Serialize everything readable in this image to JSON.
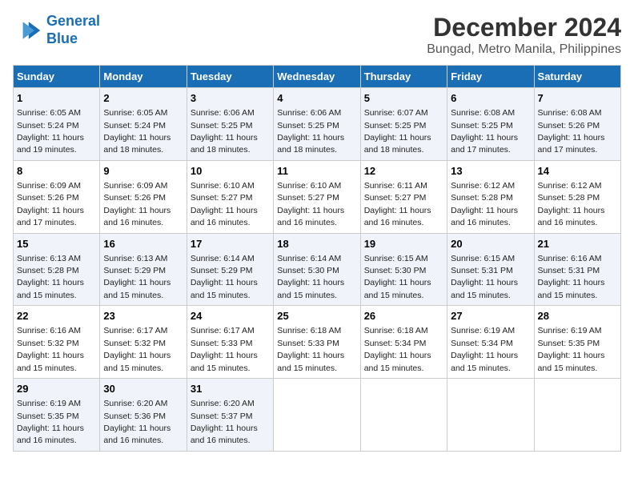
{
  "header": {
    "logo_line1": "General",
    "logo_line2": "Blue",
    "title": "December 2024",
    "subtitle": "Bungad, Metro Manila, Philippines"
  },
  "days_of_week": [
    "Sunday",
    "Monday",
    "Tuesday",
    "Wednesday",
    "Thursday",
    "Friday",
    "Saturday"
  ],
  "weeks": [
    [
      {
        "day": 1,
        "sunrise": "6:05 AM",
        "sunset": "5:24 PM",
        "daylight": "11 hours and 19 minutes."
      },
      {
        "day": 2,
        "sunrise": "6:05 AM",
        "sunset": "5:24 PM",
        "daylight": "11 hours and 18 minutes."
      },
      {
        "day": 3,
        "sunrise": "6:06 AM",
        "sunset": "5:25 PM",
        "daylight": "11 hours and 18 minutes."
      },
      {
        "day": 4,
        "sunrise": "6:06 AM",
        "sunset": "5:25 PM",
        "daylight": "11 hours and 18 minutes."
      },
      {
        "day": 5,
        "sunrise": "6:07 AM",
        "sunset": "5:25 PM",
        "daylight": "11 hours and 18 minutes."
      },
      {
        "day": 6,
        "sunrise": "6:08 AM",
        "sunset": "5:25 PM",
        "daylight": "11 hours and 17 minutes."
      },
      {
        "day": 7,
        "sunrise": "6:08 AM",
        "sunset": "5:26 PM",
        "daylight": "11 hours and 17 minutes."
      }
    ],
    [
      {
        "day": 8,
        "sunrise": "6:09 AM",
        "sunset": "5:26 PM",
        "daylight": "11 hours and 17 minutes."
      },
      {
        "day": 9,
        "sunrise": "6:09 AM",
        "sunset": "5:26 PM",
        "daylight": "11 hours and 16 minutes."
      },
      {
        "day": 10,
        "sunrise": "6:10 AM",
        "sunset": "5:27 PM",
        "daylight": "11 hours and 16 minutes."
      },
      {
        "day": 11,
        "sunrise": "6:10 AM",
        "sunset": "5:27 PM",
        "daylight": "11 hours and 16 minutes."
      },
      {
        "day": 12,
        "sunrise": "6:11 AM",
        "sunset": "5:27 PM",
        "daylight": "11 hours and 16 minutes."
      },
      {
        "day": 13,
        "sunrise": "6:12 AM",
        "sunset": "5:28 PM",
        "daylight": "11 hours and 16 minutes."
      },
      {
        "day": 14,
        "sunrise": "6:12 AM",
        "sunset": "5:28 PM",
        "daylight": "11 hours and 16 minutes."
      }
    ],
    [
      {
        "day": 15,
        "sunrise": "6:13 AM",
        "sunset": "5:28 PM",
        "daylight": "11 hours and 15 minutes."
      },
      {
        "day": 16,
        "sunrise": "6:13 AM",
        "sunset": "5:29 PM",
        "daylight": "11 hours and 15 minutes."
      },
      {
        "day": 17,
        "sunrise": "6:14 AM",
        "sunset": "5:29 PM",
        "daylight": "11 hours and 15 minutes."
      },
      {
        "day": 18,
        "sunrise": "6:14 AM",
        "sunset": "5:30 PM",
        "daylight": "11 hours and 15 minutes."
      },
      {
        "day": 19,
        "sunrise": "6:15 AM",
        "sunset": "5:30 PM",
        "daylight": "11 hours and 15 minutes."
      },
      {
        "day": 20,
        "sunrise": "6:15 AM",
        "sunset": "5:31 PM",
        "daylight": "11 hours and 15 minutes."
      },
      {
        "day": 21,
        "sunrise": "6:16 AM",
        "sunset": "5:31 PM",
        "daylight": "11 hours and 15 minutes."
      }
    ],
    [
      {
        "day": 22,
        "sunrise": "6:16 AM",
        "sunset": "5:32 PM",
        "daylight": "11 hours and 15 minutes."
      },
      {
        "day": 23,
        "sunrise": "6:17 AM",
        "sunset": "5:32 PM",
        "daylight": "11 hours and 15 minutes."
      },
      {
        "day": 24,
        "sunrise": "6:17 AM",
        "sunset": "5:33 PM",
        "daylight": "11 hours and 15 minutes."
      },
      {
        "day": 25,
        "sunrise": "6:18 AM",
        "sunset": "5:33 PM",
        "daylight": "11 hours and 15 minutes."
      },
      {
        "day": 26,
        "sunrise": "6:18 AM",
        "sunset": "5:34 PM",
        "daylight": "11 hours and 15 minutes."
      },
      {
        "day": 27,
        "sunrise": "6:19 AM",
        "sunset": "5:34 PM",
        "daylight": "11 hours and 15 minutes."
      },
      {
        "day": 28,
        "sunrise": "6:19 AM",
        "sunset": "5:35 PM",
        "daylight": "11 hours and 15 minutes."
      }
    ],
    [
      {
        "day": 29,
        "sunrise": "6:19 AM",
        "sunset": "5:35 PM",
        "daylight": "11 hours and 16 minutes."
      },
      {
        "day": 30,
        "sunrise": "6:20 AM",
        "sunset": "5:36 PM",
        "daylight": "11 hours and 16 minutes."
      },
      {
        "day": 31,
        "sunrise": "6:20 AM",
        "sunset": "5:37 PM",
        "daylight": "11 hours and 16 minutes."
      },
      null,
      null,
      null,
      null
    ]
  ]
}
